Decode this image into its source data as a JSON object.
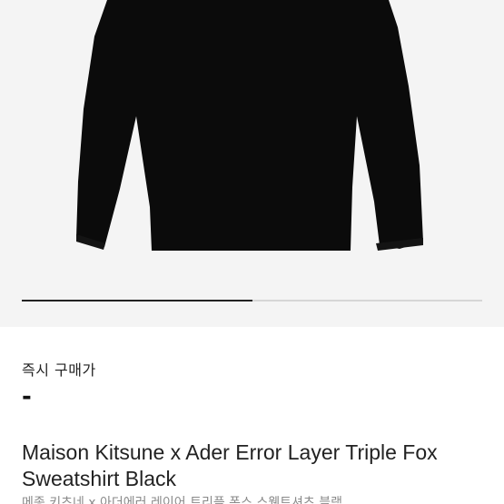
{
  "gallery": {
    "progress_fraction": 0.5
  },
  "pricing": {
    "label": "즉시 구매가",
    "value": "-"
  },
  "product": {
    "title": "Maison Kitsune x Ader Error Layer Triple Fox Sweatshirt Black",
    "subtitle": "메종 키츠네 x 아더에러 레이어 트리플 폭스 스웻트셔츠 블랙"
  },
  "colors": {
    "garment": "#0b0b0b",
    "image_background": "#f4f4f4",
    "progress_active": "#222222",
    "progress_track": "#d6d6d6"
  }
}
